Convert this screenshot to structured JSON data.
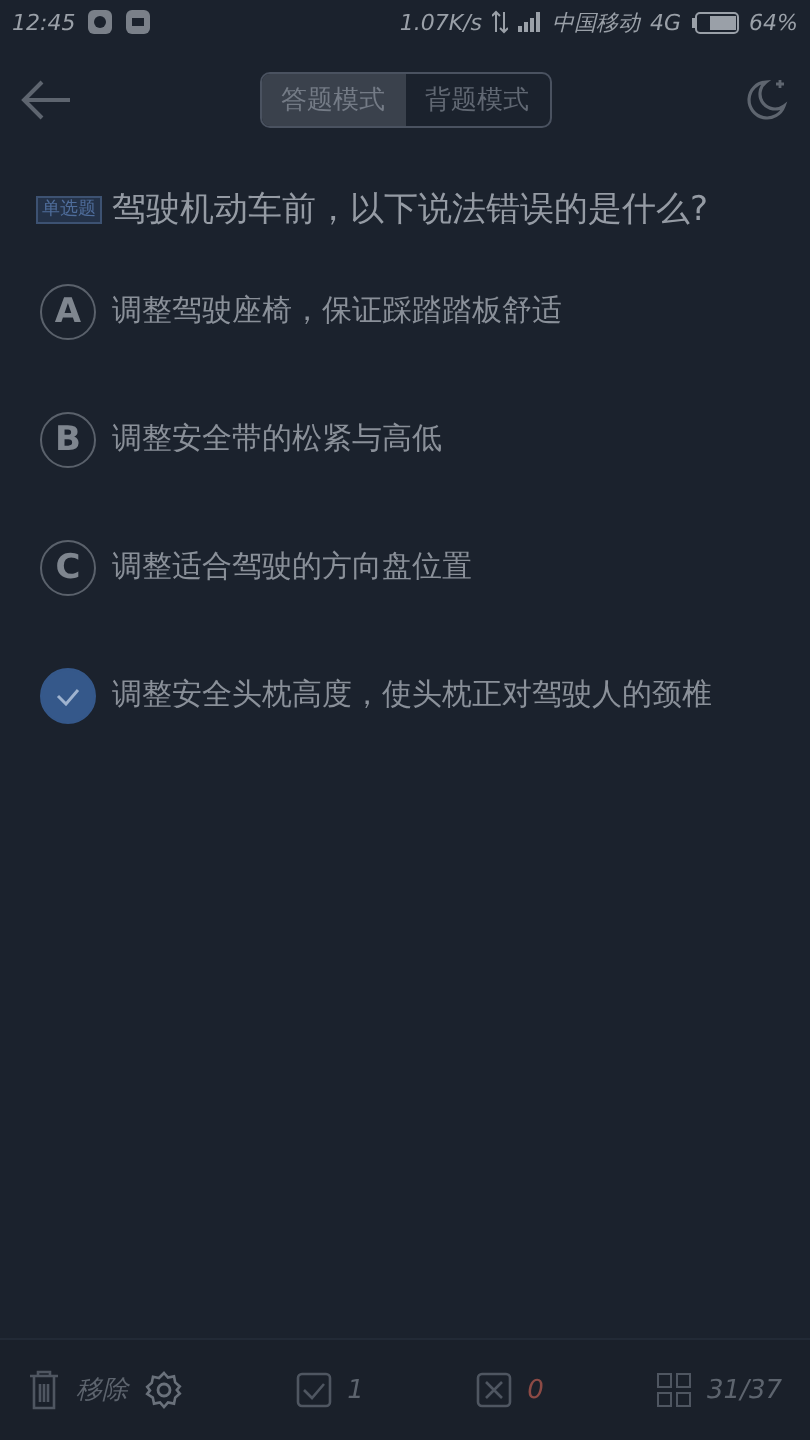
{
  "status_bar": {
    "time": "12:45",
    "speed": "1.07K/s",
    "carrier": "中国移动",
    "network": "4G",
    "battery": "64%"
  },
  "header": {
    "modes": [
      {
        "label": "答题模式",
        "selected": true
      },
      {
        "label": "背题模式",
        "selected": false
      }
    ]
  },
  "question": {
    "tag": "单选题",
    "text": "驾驶机动车前，以下说法错误的是什么?"
  },
  "options": [
    {
      "letter": "A",
      "text": "调整驾驶座椅，保证踩踏踏板舒适",
      "selected": false
    },
    {
      "letter": "B",
      "text": "调整安全带的松紧与高低",
      "selected": false
    },
    {
      "letter": "C",
      "text": "调整适合驾驶的方向盘位置",
      "selected": false
    },
    {
      "text": "调整安全头枕高度，使头枕正对驾驶人的颈椎",
      "selected": true
    }
  ],
  "bottom_bar": {
    "remove": "移除",
    "correct": "1",
    "wrong": "0",
    "progress": "31/37"
  }
}
